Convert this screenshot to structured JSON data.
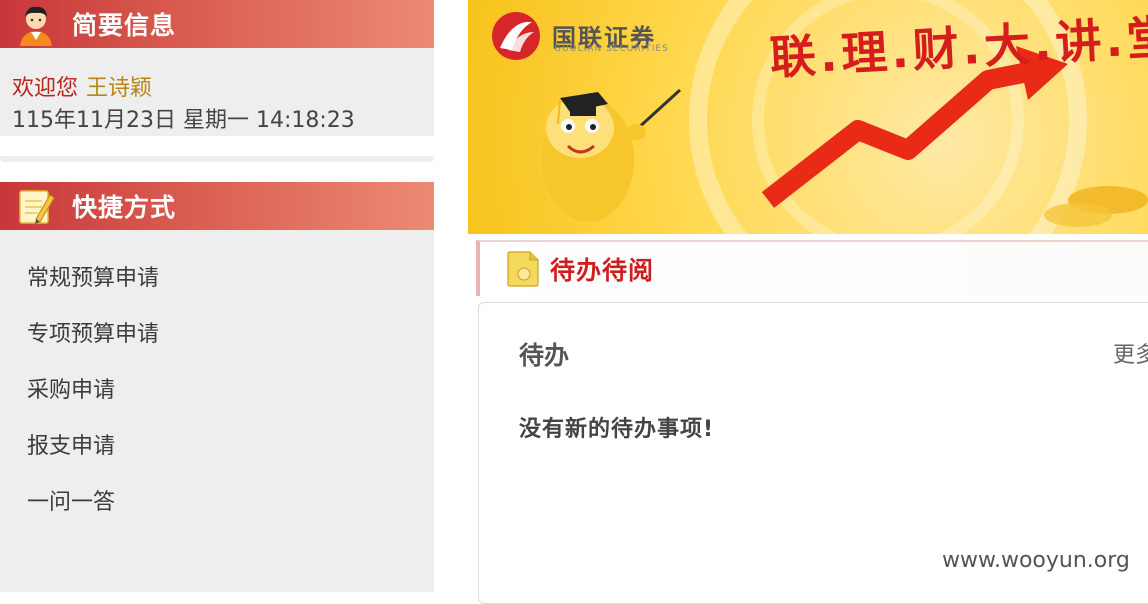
{
  "profile_panel": {
    "title": "简要信息",
    "welcome_text": "欢迎您",
    "user_name": "王诗颖",
    "datetime": "115年11月23日 星期一 14:18:23",
    "icon": "user-avatar-icon"
  },
  "shortcut_panel": {
    "title": "快捷方式",
    "icon": "notepad-pencil-icon",
    "items": [
      {
        "label": "常规预算申请"
      },
      {
        "label": "专项预算申请"
      },
      {
        "label": "采购申请"
      },
      {
        "label": "报支申请"
      },
      {
        "label": "一问一答"
      }
    ]
  },
  "banner": {
    "logo_cn": "国联证券",
    "logo_en": "GUOLIAN SECURITIES",
    "slogan": "联.理.财.大.讲.堂",
    "icon": "mascot-graduate-icon"
  },
  "todo_section": {
    "tab_title": "待办待阅",
    "tab_icon": "document-folder-icon",
    "heading": "待办",
    "more_label": "更多",
    "empty_message": "没有新的待办事项!"
  },
  "watermark": "www.wooyun.org",
  "colors": {
    "header_gradient_start": "#c8373a",
    "header_gradient_end": "#ec8a74",
    "panel_bg": "#eeeeee",
    "welcome_red": "#b7251d",
    "username_gold": "#b88611",
    "tab_title_red": "#cc1f1f"
  }
}
